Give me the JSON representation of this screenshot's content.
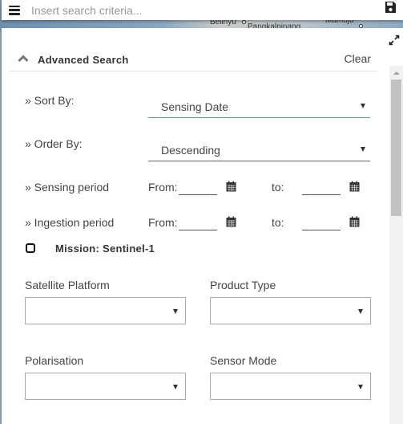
{
  "map": {
    "labels": [
      "Belinyu",
      "Pangkalpinang",
      "Mamuju"
    ]
  },
  "search": {
    "placeholder": "Insert search criteria..."
  },
  "icons": {
    "menu": "hamburger-menu-icon",
    "save": "floppy-disk-icon",
    "expand": "expand-arrows-icon",
    "collapse": "chevron-up-icon",
    "calendar": "calendar-icon",
    "dropdown": "caret-down-icon"
  },
  "advanced_search": {
    "title": "Advanced Search",
    "clear_label": "Clear",
    "sort_by": {
      "label": "» Sort By:",
      "value": "Sensing Date"
    },
    "order_by": {
      "label": "» Order By:",
      "value": "Descending"
    },
    "sensing_period": {
      "label": "» Sensing period",
      "from_label": "From:",
      "to_label": "to:",
      "from_value": "",
      "to_value": ""
    },
    "ingestion_period": {
      "label": "» Ingestion period",
      "from_label": "From:",
      "to_label": "to:",
      "from_value": "",
      "to_value": ""
    },
    "mission": {
      "title": "Mission: Sentinel-1",
      "checked": false,
      "fields": [
        {
          "label": "Satellite Platform",
          "value": ""
        },
        {
          "label": "Product Type",
          "value": ""
        },
        {
          "label": "Polarisation",
          "value": ""
        },
        {
          "label": "Sensor Mode",
          "value": ""
        }
      ]
    }
  },
  "colors": {
    "active_underline": "#5a9bc4",
    "text": "#444444",
    "map_water": "#7f9bb5"
  }
}
